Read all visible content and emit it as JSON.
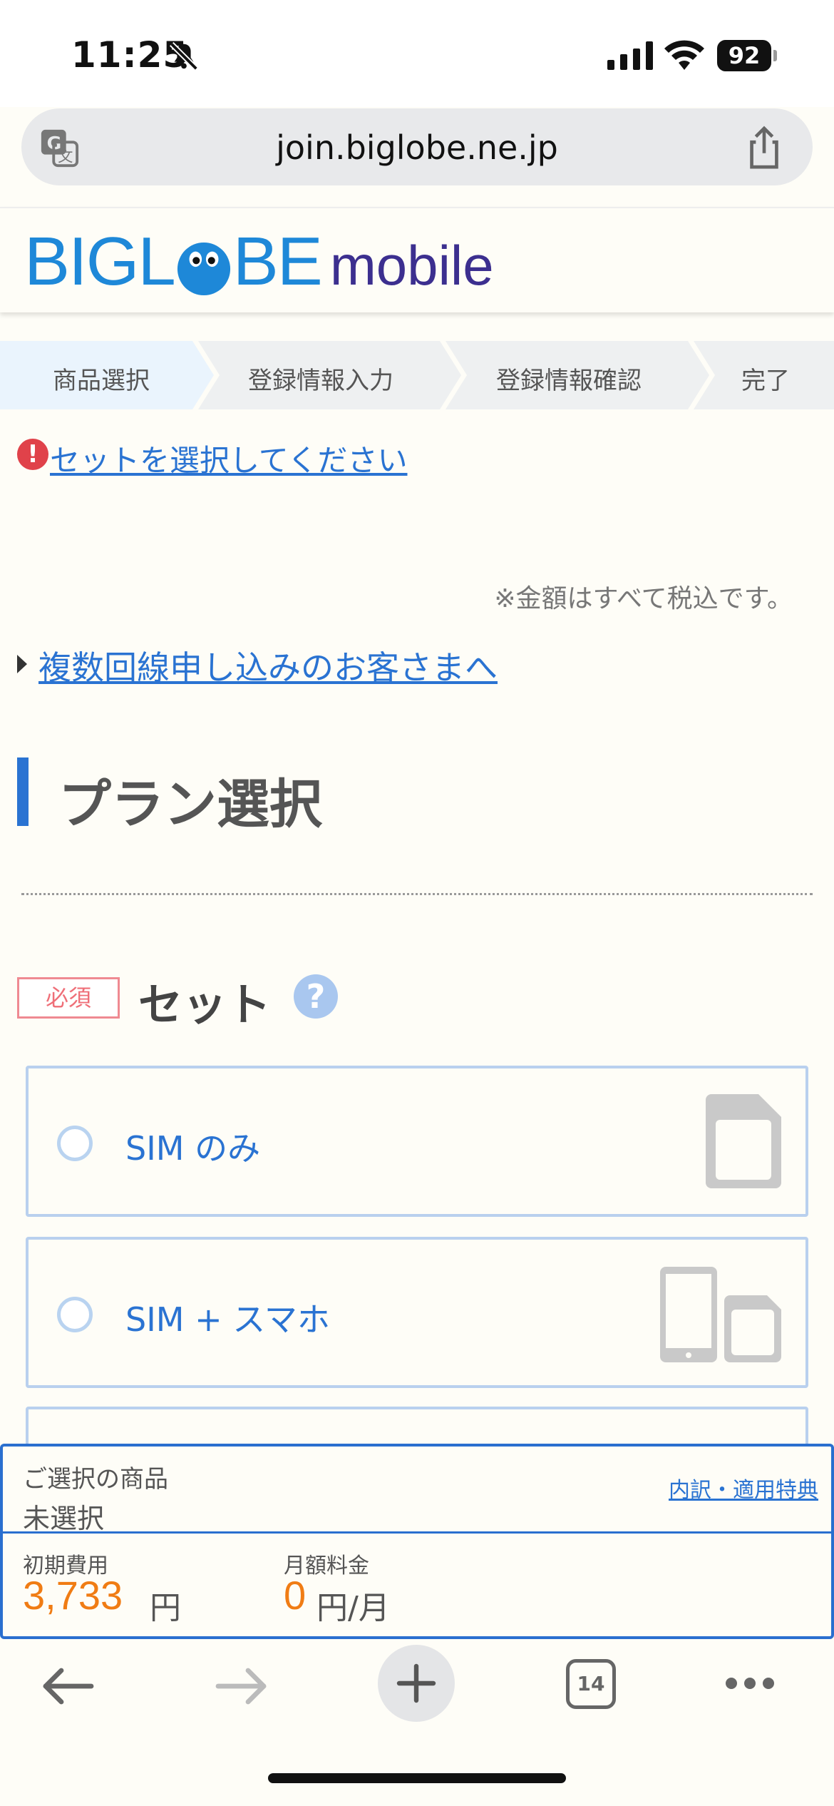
{
  "status_bar": {
    "time": "11:25",
    "battery": "92"
  },
  "browser": {
    "url": "join.biglobe.ne.jp",
    "tab_count": "14"
  },
  "logo": {
    "big_left": "BIGL",
    "big_right": "BE",
    "mobile": "mobile"
  },
  "steps": [
    "商品選択",
    "登録情報入力",
    "登録情報確認",
    "完了"
  ],
  "error_link": "セットを選択してください",
  "tax_note": "※金額はすべて税込です。",
  "multi_line_link": "複数回線申し込みのお客さまへ",
  "section_title": "プラン選択",
  "set_field": {
    "required_badge": "必須",
    "label": "セット"
  },
  "options": [
    {
      "label": "SIM のみ",
      "icon": "sim-card-icon"
    },
    {
      "label": "SIM + スマホ",
      "icon": "phone-sim-icon"
    }
  ],
  "summary": {
    "title": "ご選択の商品",
    "selected": "未選択",
    "breakdown_link": "内訳・適用特典",
    "initial_label": "初期費用",
    "initial_value": "3,733",
    "initial_unit": "円",
    "monthly_label": "月額料金",
    "monthly_value": "0",
    "monthly_unit": "円/月"
  },
  "colors": {
    "accent": "#2a73d2",
    "price": "#f07c14",
    "logo_blue": "#1e88d8",
    "logo_purple": "#3c2f8f",
    "error": "#e0424a"
  }
}
